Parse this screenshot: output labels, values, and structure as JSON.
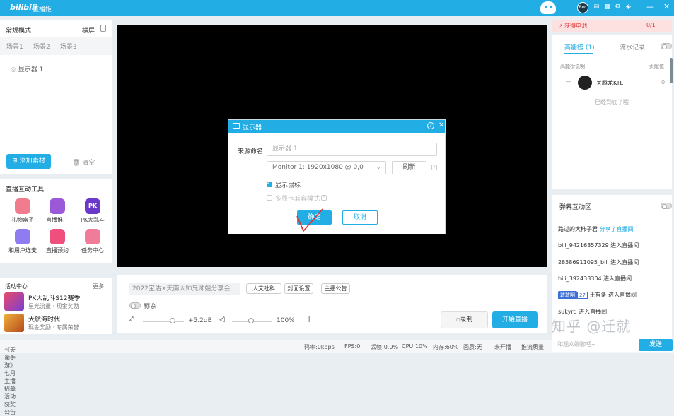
{
  "app": {
    "logo": "bilibili",
    "name": "直播姬"
  },
  "topbar": {
    "avatar_text": "Rec",
    "minimize": "—",
    "close": "✕"
  },
  "left": {
    "mode_title": "常规模式",
    "orientation": "横屏",
    "scenes": [
      "场景1",
      "场景2",
      "场景3"
    ],
    "source": "显示器 1",
    "add_material": "添加素材",
    "clear": "清空",
    "tools_title": "直播互动工具",
    "tools": [
      {
        "label": "礼物盒子",
        "color": "#f07c8e"
      },
      {
        "label": "直播推广",
        "color": "#9b59d9"
      },
      {
        "label": "PK大乱斗",
        "color": "#6b39c9"
      },
      {
        "label": "和用户连麦",
        "color": "#8e7cf0"
      },
      {
        "label": "直播预约",
        "color": "#f04e7c"
      },
      {
        "label": "任务中心",
        "color": "#f07c9a"
      }
    ],
    "activity_title": "活动中心",
    "activity_more": "更多",
    "activities": [
      {
        "name": "PK大乱斗S12赛季",
        "sub": "星光流量 · 现金奖励"
      },
      {
        "name": "大航海时代",
        "sub": "现金奖励 · 专属荣誉"
      }
    ]
  },
  "dialog": {
    "title": "显示器",
    "name_label": "来源命名",
    "name_placeholder": "显示器 1",
    "monitor_value": "Monitor 1: 1920x1080 @ 0,0",
    "refresh": "刷新",
    "show_cursor": "显示鼠标",
    "compat_mode": "多显卡兼容模式",
    "ok": "确定",
    "cancel": "取消"
  },
  "bottom": {
    "room_title": "2022宝沽×天南大师兄师姐分享会",
    "tag_buttons": [
      "人文社科",
      "封面设置",
      "主播公告"
    ],
    "preview_label": "预览",
    "mic_level": "+5.2dB",
    "speaker_level": "100%",
    "record": "录制",
    "start_live": "开始直播"
  },
  "status": {
    "announcement": "《天谕手游》七月主播招募活动获奖公告",
    "bitrate": "码率:0kbps",
    "fps": "FPS:0",
    "drop": "丢帧:0.0%",
    "cpu": "CPU:10%",
    "mem": "内存:60%",
    "quality": "画质:无",
    "live_state": "未开播",
    "push": "推流质量"
  },
  "right": {
    "battery_title": "获得电池",
    "battery_value": "0/1",
    "tabs": [
      "高能榜 (1)",
      "流水记录"
    ],
    "rank_desc": "高能榜说明",
    "rank_contrib": "贡献值",
    "rank_user": "关腾龙KTL",
    "rank_dash": "—",
    "rank_score": "0",
    "rank_end": "已经到底了哦~",
    "dm_title": "弹幕互动区",
    "dm_lines": [
      {
        "user": "路过的大柿子君",
        "action": "分享了直播间"
      },
      {
        "user": "bili_94216357329",
        "action": "进入直播间"
      },
      {
        "user": "28586911095_bili",
        "action": "进入直播间"
      },
      {
        "user": "bili_392433304",
        "action": "进入直播间"
      },
      {
        "user": "王有条",
        "action": "进入直播间",
        "badge": "敢敢明",
        "level": "27"
      },
      {
        "user": "sukyrd",
        "action": "进入直播间"
      }
    ],
    "dm_placeholder": "和观众聊聊吧~",
    "send": "发送",
    "watermark": "知乎 @迁就"
  }
}
